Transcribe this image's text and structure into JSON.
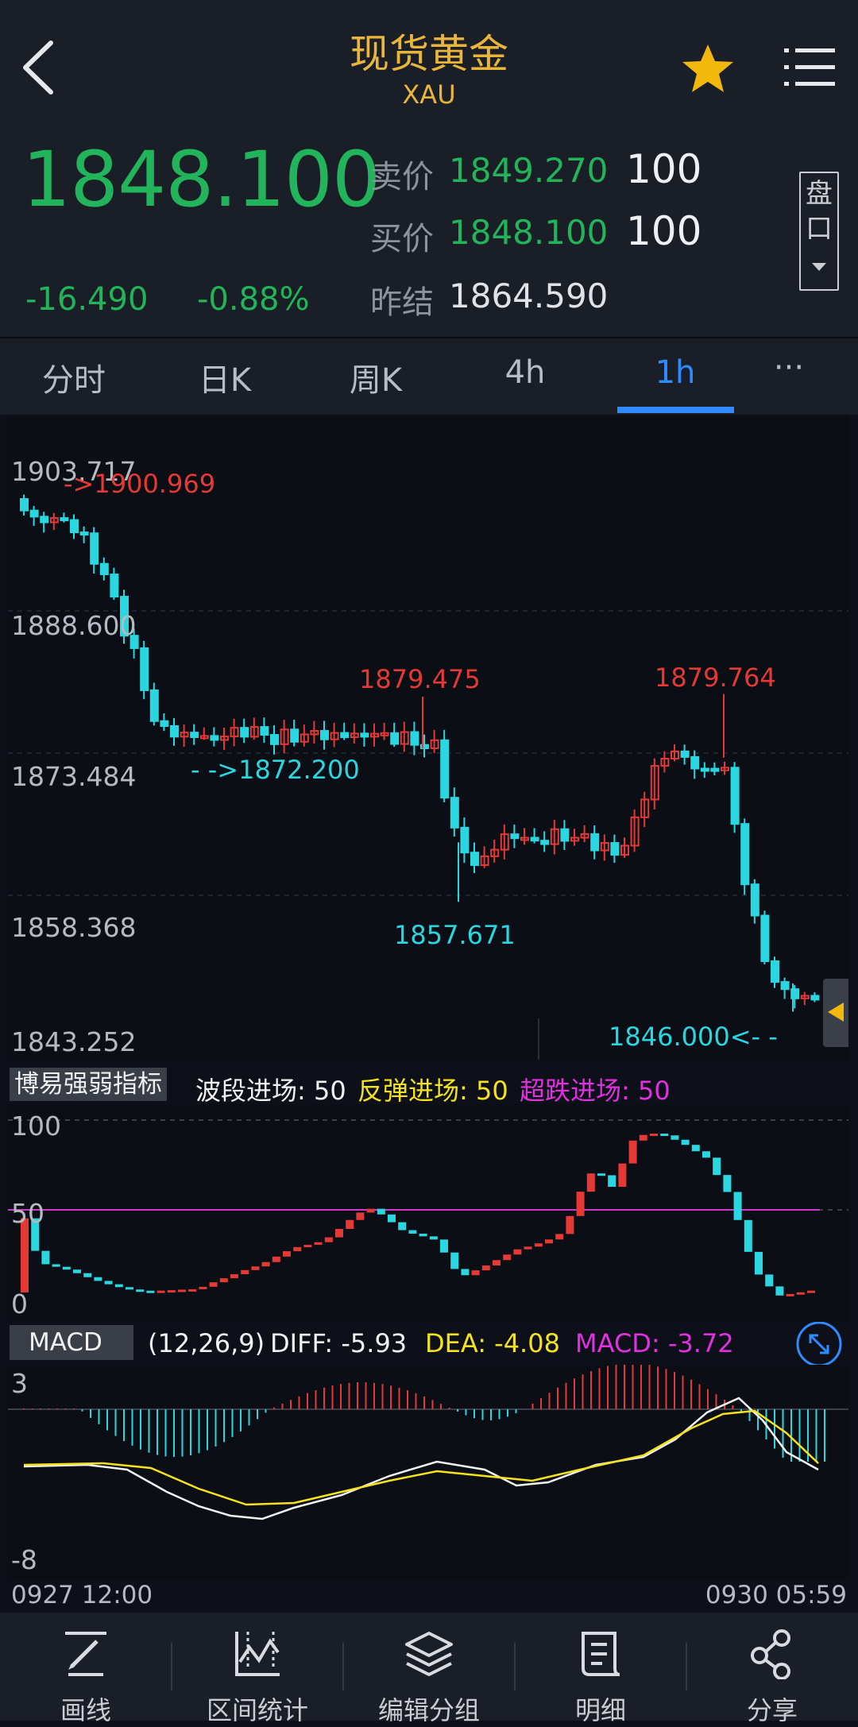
{
  "header": {
    "title": "现货黄金",
    "subtitle": "XAU"
  },
  "quote": {
    "last_price": "1848.100",
    "change": "-16.490",
    "change_pct": "-0.88%",
    "ask_label": "卖价",
    "ask_price": "1849.270",
    "ask_vol": "100",
    "bid_label": "买价",
    "bid_price": "1848.100",
    "bid_vol": "100",
    "prev_close_label": "昨结",
    "prev_close": "1864.590",
    "pankou_label": "盘口"
  },
  "tabs": [
    "分时",
    "日K",
    "周K",
    "4h",
    "1h",
    "···"
  ],
  "active_tab": "1h",
  "chart": {
    "y_labels": [
      "1903.717",
      "1888.600",
      "1873.484",
      "1858.368",
      "1843.252"
    ],
    "annotations": {
      "high_left": "->1900.969",
      "high_mid": "1879.475",
      "high_right": "1879.764",
      "low_left": "- ->1872.200",
      "low_mid": "1857.671",
      "low_right": "1846.000<- -"
    }
  },
  "indicator": {
    "name": "博易强弱指标",
    "items": [
      {
        "label": "波段进场: 50",
        "color": "#f2f2f2"
      },
      {
        "label": "反弹进场: 50",
        "color": "#f5e21e"
      },
      {
        "label": "超跌进场: 50",
        "color": "#e030e0"
      }
    ],
    "y_labels": [
      "100",
      "50",
      "0"
    ]
  },
  "macd": {
    "name": "MACD",
    "params": "(12,26,9)",
    "diff": "DIFF: -5.93",
    "dea": "DEA: -4.08",
    "macd": "MACD: -3.72",
    "y_labels": [
      "3",
      "-8"
    ]
  },
  "time_axis": {
    "start": "0927 12:00",
    "end": "0930 05:59"
  },
  "bottom_nav": [
    {
      "label": "画线",
      "icon": "draw-line-icon"
    },
    {
      "label": "区间统计",
      "icon": "range-stats-icon"
    },
    {
      "label": "编辑分组",
      "icon": "edit-group-icon"
    },
    {
      "label": "明细",
      "icon": "detail-icon"
    },
    {
      "label": "分享",
      "icon": "share-icon"
    }
  ],
  "colors": {
    "up": "#e53935",
    "down": "#2ad6e0",
    "gold": "#e9b53a",
    "green": "#22b45a",
    "accent": "#2f8bff"
  }
}
